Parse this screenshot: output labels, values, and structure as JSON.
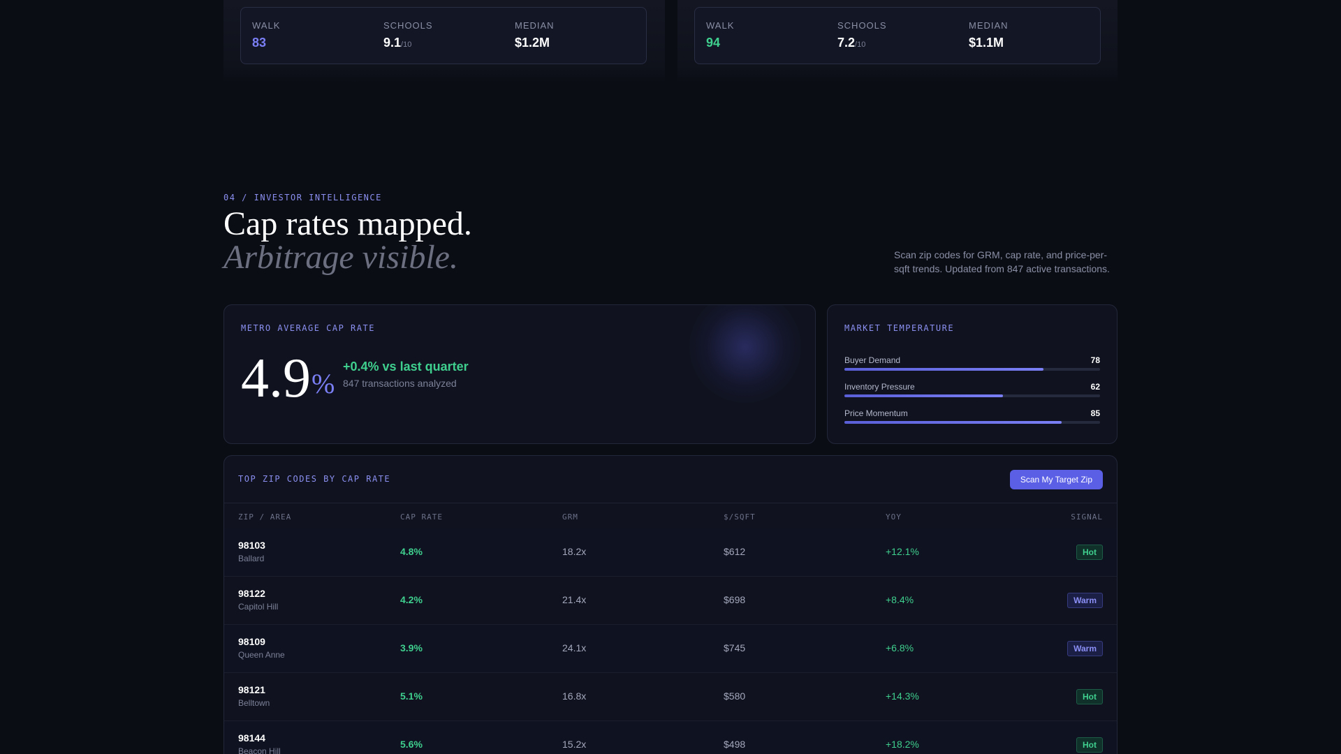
{
  "neighborhood_cards": [
    {
      "stats": [
        {
          "label": "WALK",
          "value": "83",
          "suffix": ""
        },
        {
          "label": "SCHOOLS",
          "value": "9.1",
          "suffix": "/10"
        },
        {
          "label": "MEDIAN",
          "value": "$1.2M",
          "suffix": ""
        }
      ]
    },
    {
      "stats": [
        {
          "label": "WALK",
          "value": "94",
          "suffix": ""
        },
        {
          "label": "SCHOOLS",
          "value": "7.2",
          "suffix": "/10"
        },
        {
          "label": "MEDIAN",
          "value": "$1.1M",
          "suffix": ""
        }
      ]
    }
  ],
  "section": {
    "eyebrow": "04 / INVESTOR INTELLIGENCE",
    "headline": "Cap rates mapped.",
    "headline_italic": "Arbitrage visible.",
    "description": "Scan zip codes for GRM, cap rate, and price-per-sqft trends. Updated from 847 active transactions."
  },
  "cap_rate_panel": {
    "title": "METRO AVERAGE CAP RATE",
    "value": "4.9",
    "unit": "%",
    "delta": "+0.4% vs last quarter",
    "note": "847 transactions analyzed"
  },
  "market_temperature": {
    "title": "MARKET TEMPERATURE",
    "metrics": [
      {
        "label": "Buyer Demand",
        "value": 78
      },
      {
        "label": "Inventory Pressure",
        "value": 62
      },
      {
        "label": "Price Momentum",
        "value": 85
      }
    ]
  },
  "zip_table": {
    "title": "TOP ZIP CODES BY CAP RATE",
    "button_label": "Scan My Target Zip",
    "columns": [
      "ZIP / AREA",
      "CAP RATE",
      "GRM",
      "$/SQFT",
      "YOY",
      "SIGNAL"
    ],
    "rows": [
      {
        "zip": "98103",
        "area": "Ballard",
        "cap": "4.8%",
        "grm": "18.2x",
        "sqft": "$612",
        "yoy": "+12.1%",
        "signal": "Hot"
      },
      {
        "zip": "98122",
        "area": "Capitol Hill",
        "cap": "4.2%",
        "grm": "21.4x",
        "sqft": "$698",
        "yoy": "+8.4%",
        "signal": "Warm"
      },
      {
        "zip": "98109",
        "area": "Queen Anne",
        "cap": "3.9%",
        "grm": "24.1x",
        "sqft": "$745",
        "yoy": "+6.8%",
        "signal": "Warm"
      },
      {
        "zip": "98121",
        "area": "Belltown",
        "cap": "5.1%",
        "grm": "16.8x",
        "sqft": "$580",
        "yoy": "+14.3%",
        "signal": "Hot"
      },
      {
        "zip": "98144",
        "area": "Beacon Hill",
        "cap": "5.6%",
        "grm": "15.2x",
        "sqft": "$498",
        "yoy": "+18.2%",
        "signal": "Hot"
      }
    ]
  },
  "colors": {
    "background": "#0b0d15",
    "accent": "#7b7ff5",
    "positive": "#3fcf8e",
    "button": "#5b5fe6"
  }
}
